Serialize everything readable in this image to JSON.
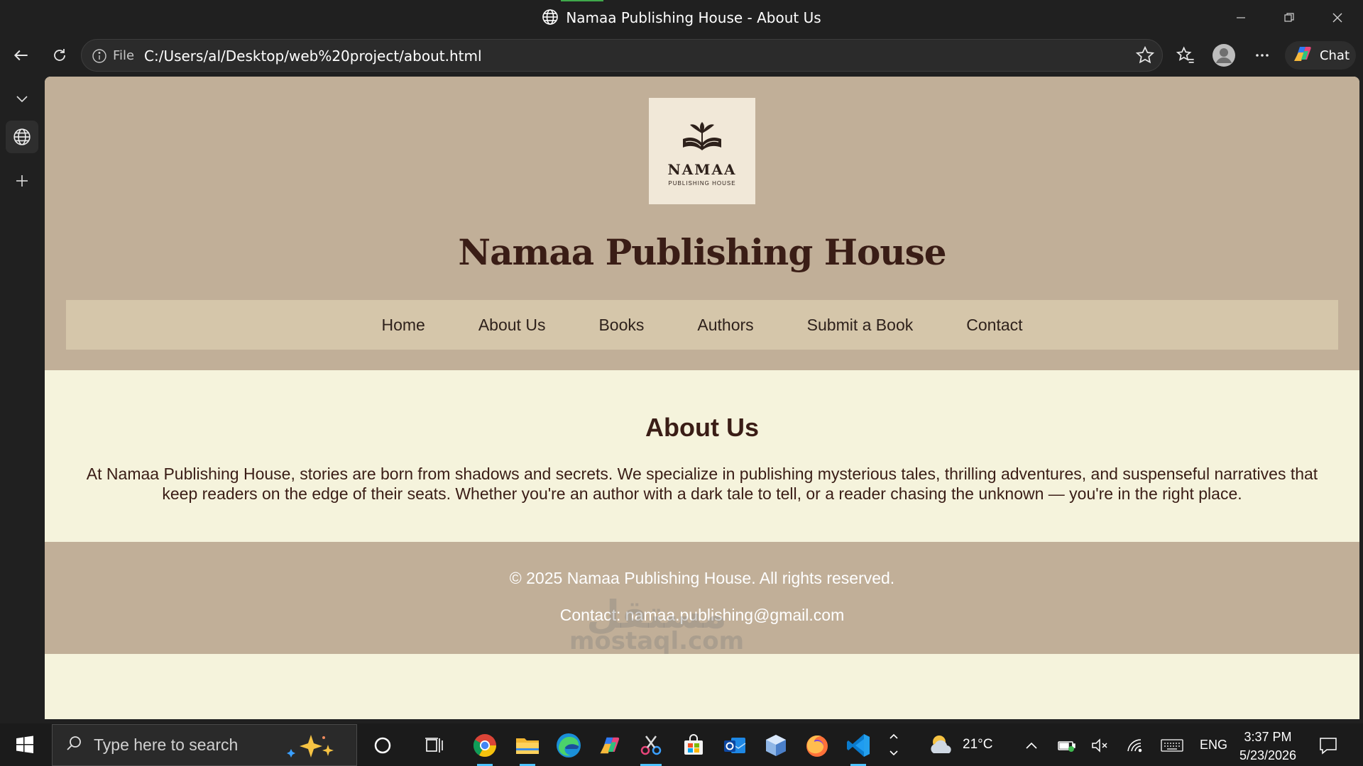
{
  "window": {
    "title": "Namaa Publishing House - About Us"
  },
  "browser": {
    "address_scheme": "File",
    "url": "C:/Users/al/Desktop/web%20project/about.html",
    "chat_label": "Chat"
  },
  "site": {
    "logo": {
      "name": "NAMAA",
      "tagline": "PUBLISHING HOUSE"
    },
    "title": "Namaa Publishing House",
    "nav": [
      {
        "label": "Home"
      },
      {
        "label": "About Us"
      },
      {
        "label": "Books"
      },
      {
        "label": "Authors"
      },
      {
        "label": "Submit a Book"
      },
      {
        "label": "Contact"
      }
    ],
    "about": {
      "heading": "About Us",
      "body": "At Namaa Publishing House, stories are born from shadows and secrets. We specialize in publishing mysterious tales, thrilling adventures, and suspenseful narratives that keep readers on the edge of their seats. Whether you're an author with a dark tale to tell, or a reader chasing the unknown — you're in the right place."
    },
    "footer": {
      "copyright": "© 2025 Namaa Publishing House. All rights reserved.",
      "contact": "Contact: namaa.publishing@gmail.com"
    },
    "colors": {
      "header_bg": "#c1af98",
      "nav_bg": "#d5c6aa",
      "content_bg": "#f5f3dc",
      "title_color": "#3a1d16"
    }
  },
  "watermark": {
    "arabic": "مستقل",
    "latin": "mostaql.com"
  },
  "taskbar": {
    "search_placeholder": "Type here to search",
    "weather": "21°C",
    "language": "ENG",
    "time": "3:37 PM",
    "date": "5/23/2026",
    "pinned_icons": [
      "cortana-icon",
      "task-view-icon",
      "chrome-icon",
      "file-explorer-icon",
      "edge-icon",
      "copilot-icon",
      "snipping-tool-icon",
      "store-icon",
      "outlook-icon",
      "box-app-icon",
      "firefox-icon",
      "vscode-icon"
    ]
  }
}
